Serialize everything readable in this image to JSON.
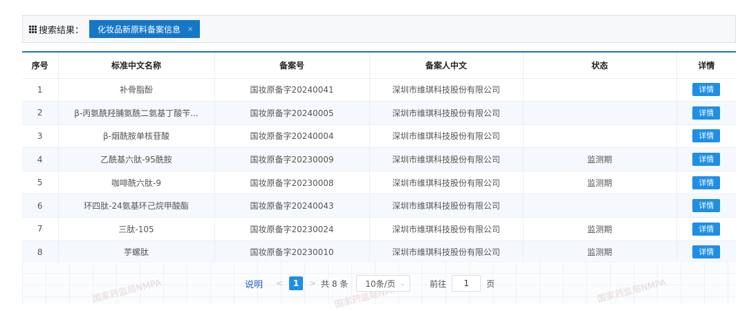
{
  "search": {
    "label": "搜索结果：",
    "tag": "化妆品新原料备案信息",
    "tag_close": "×"
  },
  "table": {
    "columns": [
      "序号",
      "标准中文名称",
      "备案号",
      "备案人中文",
      "状态",
      "详情"
    ],
    "rows": [
      {
        "index": "1",
        "name": "补骨脂酚",
        "record_no": "国妆原备字20240041",
        "filer": "深圳市维琪科技股份有限公司",
        "status": "",
        "detail": "详情"
      },
      {
        "index": "2",
        "name": "β-丙氨酰羟脯氨酰二氨基丁酸苄...",
        "record_no": "国妆原备字20240005",
        "filer": "深圳市维琪科技股份有限公司",
        "status": "",
        "detail": "详情"
      },
      {
        "index": "3",
        "name": "β-烟酰胺单核苷酸",
        "record_no": "国妆原备字20240004",
        "filer": "深圳市维琪科技股份有限公司",
        "status": "",
        "detail": "详情"
      },
      {
        "index": "4",
        "name": "乙酰基六肽-95酰胺",
        "record_no": "国妆原备字20230009",
        "filer": "深圳市维琪科技股份有限公司",
        "status": "监测期",
        "detail": "详情"
      },
      {
        "index": "5",
        "name": "咖啡酰六肽-9",
        "record_no": "国妆原备字20230008",
        "filer": "深圳市维琪科技股份有限公司",
        "status": "监测期",
        "detail": "详情"
      },
      {
        "index": "6",
        "name": "环四肽-24氨基环己烷甲酸酯",
        "record_no": "国妆原备字20240043",
        "filer": "深圳市维琪科技股份有限公司",
        "status": "",
        "detail": "详情"
      },
      {
        "index": "7",
        "name": "三肽-105",
        "record_no": "国妆原备字20230024",
        "filer": "深圳市维琪科技股份有限公司",
        "status": "监测期",
        "detail": "详情"
      },
      {
        "index": "8",
        "name": "芋螺肽",
        "record_no": "国妆原备字20230010",
        "filer": "深圳市维琪科技股份有限公司",
        "status": "监测期",
        "detail": "详情"
      }
    ]
  },
  "pagination": {
    "explain": "说明",
    "prev": "<",
    "current_page": "1",
    "next": ">",
    "total": "共 8 条",
    "page_size": "10条/页",
    "goto_prefix": "前往",
    "goto_value": "1",
    "goto_suffix": "页"
  },
  "watermark": "国家药监局NMPA",
  "colors": {
    "accent": "#1677c8",
    "button": "#1f8fe5",
    "stripe": "#f5f8fd"
  }
}
